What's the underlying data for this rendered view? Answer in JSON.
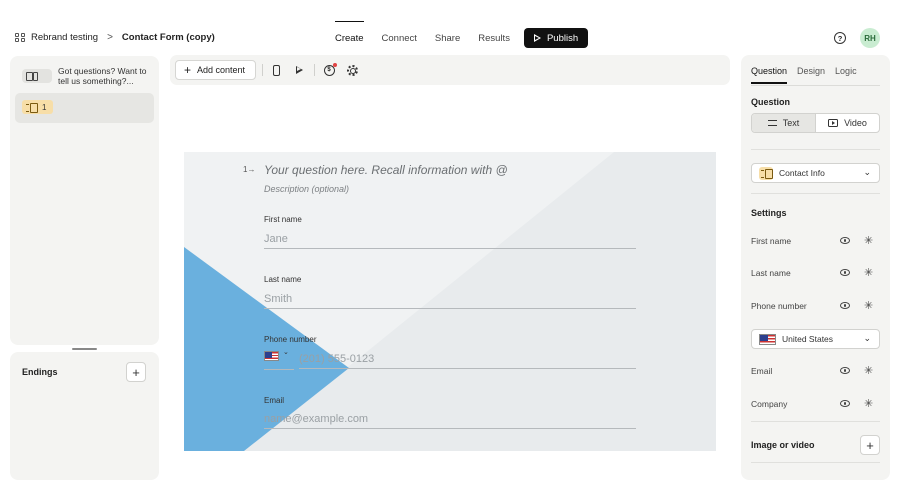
{
  "header": {
    "workspace": "Rebrand testing",
    "separator": ">",
    "form_name": "Contact Form (copy)",
    "tabs": [
      {
        "label": "Create",
        "active": true
      },
      {
        "label": "Connect",
        "active": false
      },
      {
        "label": "Share",
        "active": false
      },
      {
        "label": "Results",
        "active": false
      }
    ],
    "publish_label": "Publish",
    "help_symbol": "?",
    "avatar_initials": "RH"
  },
  "left_panel": {
    "welcome_text": "Got questions? Want to tell us something?...",
    "question_number": "1"
  },
  "endings": {
    "title": "Endings",
    "add_symbol": "+"
  },
  "toolbar": {
    "add_content_label": "Add content",
    "add_symbol": "+",
    "coin_symbol": "$"
  },
  "form": {
    "question_number": "1→",
    "question_title": "Your question here. Recall information with @",
    "description": "Description (optional)",
    "fields": [
      {
        "label": "First name",
        "placeholder": "Jane"
      },
      {
        "label": "Last name",
        "placeholder": "Smith"
      },
      {
        "label": "Phone number",
        "placeholder": "(201) 555-0123"
      },
      {
        "label": "Email",
        "placeholder": "name@example.com"
      }
    ],
    "flag_chevron": "⌄",
    "colors": {
      "accent_shape": "#6ab0de",
      "background": "#e8ebed",
      "light_panel": "#f0f2f3"
    }
  },
  "right_panel": {
    "tabs": [
      {
        "label": "Question",
        "active": true
      },
      {
        "label": "Design",
        "active": false
      },
      {
        "label": "Logic",
        "active": false
      }
    ],
    "question_heading": "Question",
    "answer_types": [
      {
        "label": "Text",
        "active": true
      },
      {
        "label": "Video",
        "active": false
      }
    ],
    "question_type": "Contact Info",
    "settings_heading": "Settings",
    "settings": [
      {
        "label": "First name"
      },
      {
        "label": "Last name"
      },
      {
        "label": "Phone number"
      },
      {
        "label": "Email"
      },
      {
        "label": "Company"
      }
    ],
    "country": "United States",
    "chevron": "⌄",
    "asterisk": "✳",
    "image_video_label": "Image or video",
    "add_symbol": "+"
  }
}
